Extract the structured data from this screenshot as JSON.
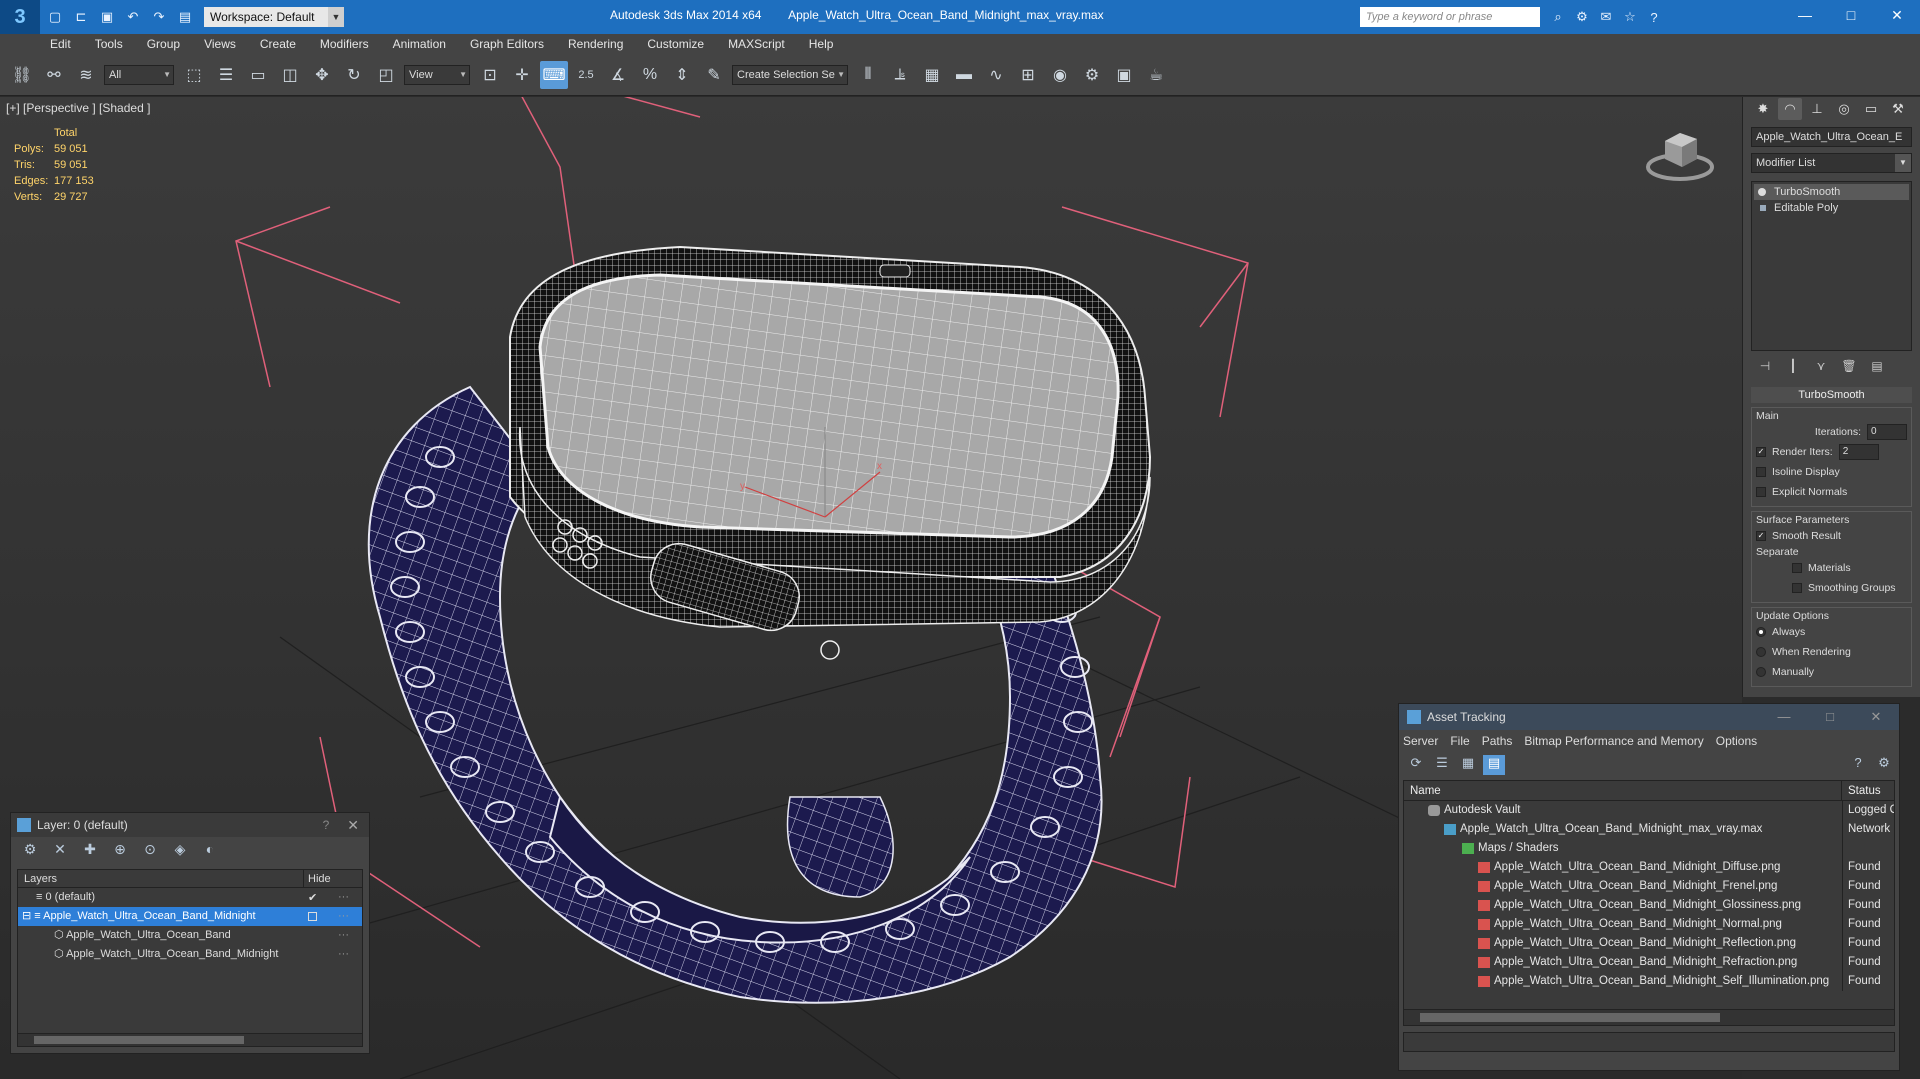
{
  "titlebar": {
    "app_title": "Autodesk 3ds Max  2014 x64",
    "file_title": "Apple_Watch_Ultra_Ocean_Band_Midnight_max_vray.max",
    "workspace": "Workspace: Default",
    "search_placeholder": "Type a keyword or phrase"
  },
  "menu": [
    "Edit",
    "Tools",
    "Group",
    "Views",
    "Create",
    "Modifiers",
    "Animation",
    "Graph Editors",
    "Rendering",
    "Customize",
    "MAXScript",
    "Help"
  ],
  "toolbar": {
    "selection_filter": "All",
    "ref_coord": "View",
    "named_selection": "Create Selection Se",
    "snap_label": "2.5"
  },
  "viewport": {
    "label": "[+] [Perspective ] [Shaded ]",
    "stats": {
      "header": "Total",
      "rows": [
        {
          "k": "Polys:",
          "v": "59 051"
        },
        {
          "k": "Tris:",
          "v": "59 051"
        },
        {
          "k": "Edges:",
          "v": "177 153"
        },
        {
          "k": "Verts:",
          "v": "29 727"
        }
      ]
    },
    "axis_x": "x",
    "axis_y": "y"
  },
  "command_panel": {
    "object_name": "Apple_Watch_Ultra_Ocean_E",
    "modifier_list": "Modifier List",
    "stack": [
      "TurboSmooth",
      "Editable Poly"
    ],
    "rollout_title": "TurboSmooth",
    "main_group": "Main",
    "iterations_label": "Iterations:",
    "iterations_value": "0",
    "render_iters_label": "Render Iters:",
    "render_iters_value": "2",
    "isoline_label": "Isoline Display",
    "explicit_normals_label": "Explicit Normals",
    "surface_group": "Surface Parameters",
    "smooth_result_label": "Smooth Result",
    "separate_label": "Separate",
    "materials_label": "Materials",
    "smoothing_groups_label": "Smoothing Groups",
    "update_group": "Update Options",
    "always_label": "Always",
    "when_rendering_label": "When Rendering",
    "manually_label": "Manually"
  },
  "layer_panel": {
    "title": "Layer: 0 (default)",
    "help": "?",
    "col_layers": "Layers",
    "col_hide": "Hide",
    "rows": [
      {
        "name": "0 (default)",
        "indent": 0
      },
      {
        "name": "Apple_Watch_Ultra_Ocean_Band_Midnight",
        "indent": 1
      },
      {
        "name": "Apple_Watch_Ultra_Ocean_Band",
        "indent": 2
      },
      {
        "name": "Apple_Watch_Ultra_Ocean_Band_Midnight",
        "indent": 2
      }
    ]
  },
  "asset_panel": {
    "title": "Asset Tracking",
    "menu": [
      "Server",
      "File",
      "Paths",
      "Bitmap Performance and Memory",
      "Options"
    ],
    "col_name": "Name",
    "col_status": "Status",
    "rows": [
      {
        "name": "Autodesk Vault",
        "status": "Logged O",
        "indent": 1,
        "icon": "vault"
      },
      {
        "name": "Apple_Watch_Ultra_Ocean_Band_Midnight_max_vray.max",
        "status": "Network",
        "indent": 2,
        "icon": "max"
      },
      {
        "name": "Maps / Shaders",
        "status": "",
        "indent": 3,
        "icon": "maps"
      },
      {
        "name": "Apple_Watch_Ultra_Ocean_Band_Midnight_Diffuse.png",
        "status": "Found",
        "indent": 4,
        "icon": "png"
      },
      {
        "name": "Apple_Watch_Ultra_Ocean_Band_Midnight_Frenel.png",
        "status": "Found",
        "indent": 4,
        "icon": "png"
      },
      {
        "name": "Apple_Watch_Ultra_Ocean_Band_Midnight_Glossiness.png",
        "status": "Found",
        "indent": 4,
        "icon": "png"
      },
      {
        "name": "Apple_Watch_Ultra_Ocean_Band_Midnight_Normal.png",
        "status": "Found",
        "indent": 4,
        "icon": "png"
      },
      {
        "name": "Apple_Watch_Ultra_Ocean_Band_Midnight_Reflection.png",
        "status": "Found",
        "indent": 4,
        "icon": "png"
      },
      {
        "name": "Apple_Watch_Ultra_Ocean_Band_Midnight_Refraction.png",
        "status": "Found",
        "indent": 4,
        "icon": "png"
      },
      {
        "name": "Apple_Watch_Ultra_Ocean_Band_Midnight_Self_Illumination.png",
        "status": "Found",
        "indent": 4,
        "icon": "png"
      }
    ]
  },
  "colors": {
    "title_bar": "#1e6fbf",
    "selection": "#2e7fd8",
    "stats_text": "#ffd46a",
    "bbox": "#e0607a"
  }
}
